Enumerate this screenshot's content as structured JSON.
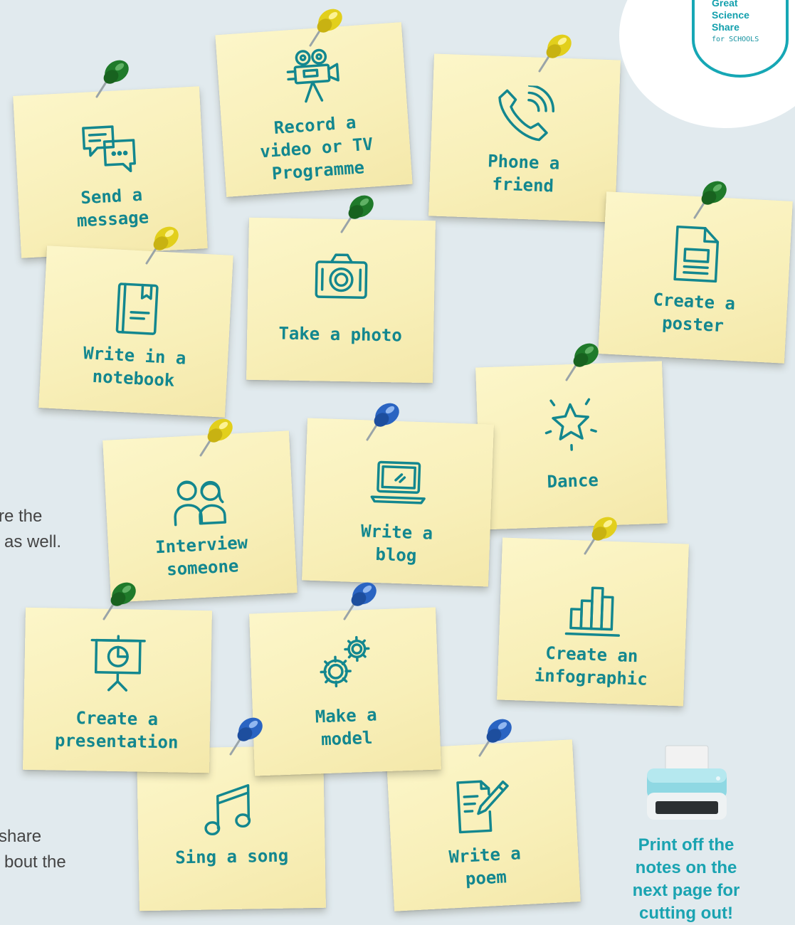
{
  "logo": {
    "lines": [
      "Great",
      "Science",
      "Share"
    ],
    "subtitle": "for SCHOOLS",
    "color": "#16a7b5"
  },
  "side_text": {
    "line1": "re the",
    "line2": "as well.",
    "line3": "share",
    "line4": "bout the"
  },
  "notes": [
    {
      "icon": "chat-bubbles-icon",
      "lines": [
        "Send a",
        "message"
      ]
    },
    {
      "icon": "video-camera-icon",
      "lines": [
        "Record a",
        "video or TV",
        "Programme"
      ]
    },
    {
      "icon": "phone-icon",
      "lines": [
        "Phone a",
        "friend"
      ]
    },
    {
      "icon": "notebook-icon",
      "lines": [
        "Write in a",
        "notebook"
      ]
    },
    {
      "icon": "camera-icon",
      "lines": [
        "Take a photo"
      ]
    },
    {
      "icon": "poster-icon",
      "lines": [
        "Create a",
        "poster"
      ]
    },
    {
      "icon": "star-icon",
      "lines": [
        "Dance"
      ]
    },
    {
      "icon": "people-icon",
      "lines": [
        "Interview",
        "someone"
      ]
    },
    {
      "icon": "laptop-icon",
      "lines": [
        "Write a",
        "blog"
      ]
    },
    {
      "icon": "bar-chart-icon",
      "lines": [
        "Create an",
        "infographic"
      ]
    },
    {
      "icon": "presentation-icon",
      "lines": [
        "Create a",
        "presentation"
      ]
    },
    {
      "icon": "gears-icon",
      "lines": [
        "Make a",
        "model"
      ]
    },
    {
      "icon": "music-note-icon",
      "lines": [
        "Sing a song"
      ]
    },
    {
      "icon": "pencil-paper-icon",
      "lines": [
        "Write a",
        "poem"
      ]
    }
  ],
  "print_cta": {
    "icon": "printer-icon",
    "lines": [
      "Print off the",
      "notes on the",
      "next page for",
      "cutting out!"
    ]
  },
  "colors": {
    "background": "#e1eaee",
    "note": "#fbf4c3",
    "ink": "#13878f",
    "accent": "#1aa3b1",
    "pin_green": "#1f7a2a",
    "pin_yellow": "#e2cf1c",
    "pin_blue": "#2a64c2"
  }
}
